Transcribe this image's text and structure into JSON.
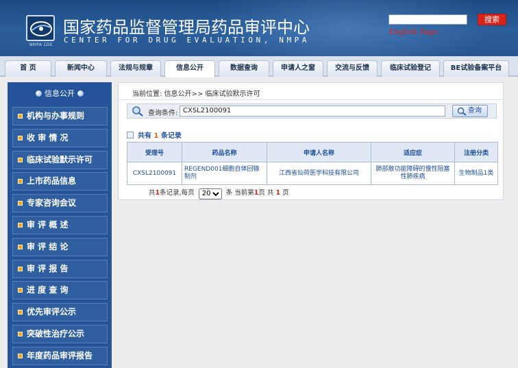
{
  "header": {
    "cn_title": "国家药品监督管理局药品审评中心",
    "en_title": "CENTER FOR DRUG EVALUATION, NMPA",
    "logo_caption": "NMPA CDE",
    "search_button": "搜索",
    "english_link": "English Page"
  },
  "nav": {
    "tabs": [
      {
        "label": "首 页"
      },
      {
        "label": "新闻中心"
      },
      {
        "label": "法规与规章"
      },
      {
        "label": "信息公开",
        "active": true
      },
      {
        "label": "数据查询"
      },
      {
        "label": "申请人之窗"
      },
      {
        "label": "交流与反馈"
      },
      {
        "label": "临床试验登记"
      },
      {
        "label": "BE试验备案平台"
      }
    ]
  },
  "sidebar": {
    "title": "信息公开",
    "items": [
      {
        "label": "机构与办事规则"
      },
      {
        "label": "收 审 情 况"
      },
      {
        "label": "临床试验默示许可"
      },
      {
        "label": "上市药品信息"
      },
      {
        "label": "专家咨询会议"
      },
      {
        "label": "审 评 概 述"
      },
      {
        "label": "审 评 结 论"
      },
      {
        "label": "审 评 报 告"
      },
      {
        "label": "进 度 查 询"
      },
      {
        "label": "优先审评公示"
      },
      {
        "label": "突破性治疗公示"
      },
      {
        "label": "年度药品审评报告"
      }
    ]
  },
  "breadcrumb": {
    "prefix": "当前位置:",
    "path": "信息公开>> 临床试验默示许可"
  },
  "query": {
    "label": "查询条件:",
    "value": "CXSL2100091",
    "button": "查询"
  },
  "summary": {
    "prefix": "共有",
    "count": "1",
    "suffix": "条记录"
  },
  "table": {
    "headers": [
      "受理号",
      "药品名称",
      "申请人名称",
      "适应症",
      "注册分类"
    ],
    "rows": [
      [
        "CXSL2100091",
        "REGEND001细胞自体回输制剂",
        "江西省仙荷医学科技有限公司",
        "肺部散功能障碍的慢性阻塞性肺疾病",
        "生物制品1类"
      ]
    ]
  },
  "pager": {
    "total_prefix": "共",
    "total": "1",
    "total_suffix": "条记录,每页",
    "page_size": "20",
    "current_prefix": "条 当前第",
    "current": "1",
    "current_mid": "页 共",
    "pages": "1",
    "pages_suffix": "页"
  },
  "colors": {
    "header_blue": "#2a5e9a",
    "sidebar_blue": "#24539a",
    "accent_red": "#d8231c",
    "bullet_orange": "#f5a623"
  }
}
